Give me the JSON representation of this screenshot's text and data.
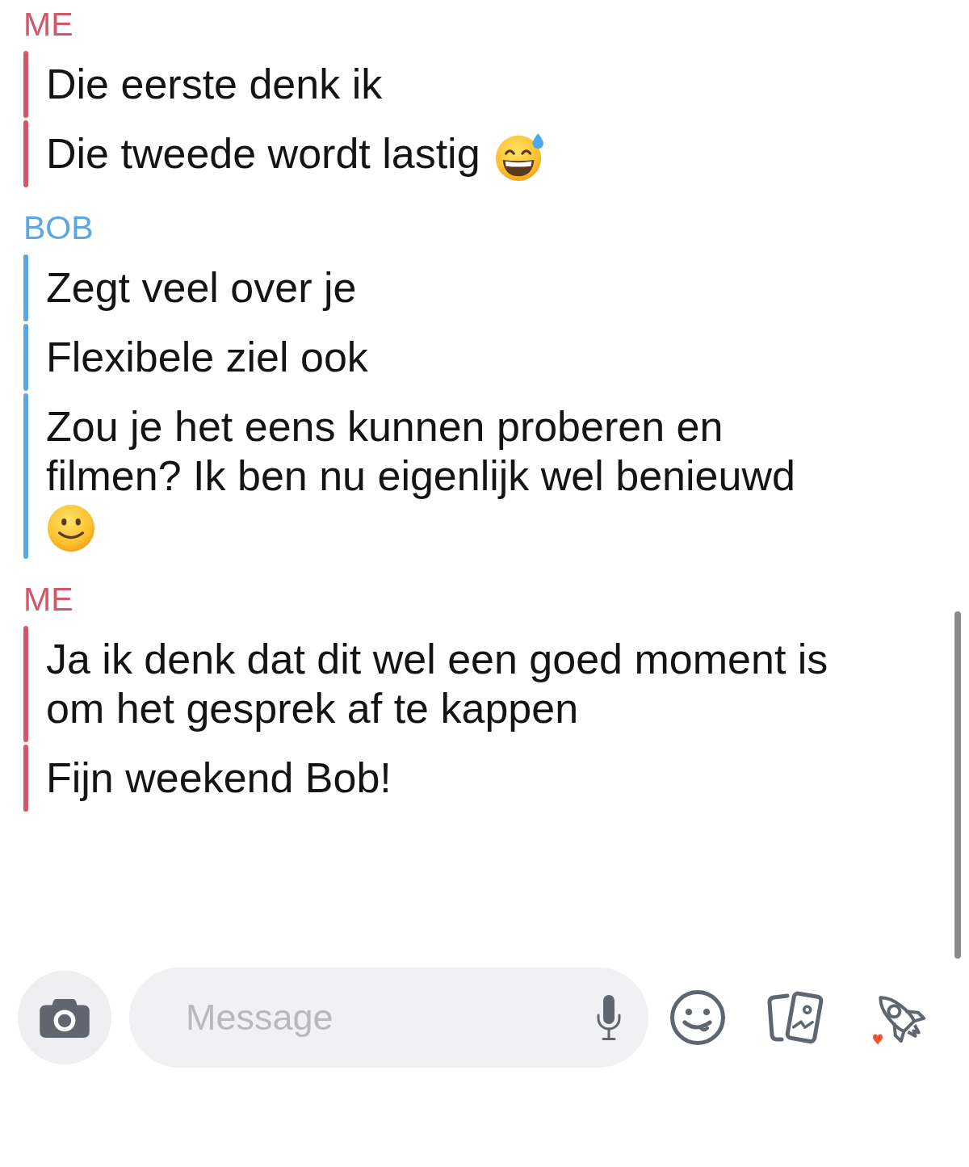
{
  "conversation": [
    {
      "sender": "ME",
      "color": "#d4566a",
      "messages": [
        {
          "kind": "plain",
          "text": "Die eerste denk ik"
        },
        {
          "kind": "grinsweat",
          "text": "Die tweede wordt lastig"
        }
      ]
    },
    {
      "sender": "BOB",
      "color": "#5aa7e4",
      "messages": [
        {
          "kind": "plain",
          "text": "Zegt veel over je"
        },
        {
          "kind": "plain",
          "text": "Flexibele ziel ook"
        },
        {
          "kind": "smile",
          "text": "Zou je het eens kunnen proberen en filmen? Ik ben nu eigenlijk wel benieuwd"
        }
      ]
    },
    {
      "sender": "ME",
      "color": "#d4566a",
      "messages": [
        {
          "kind": "plain",
          "text": "Ja ik denk dat dit wel een goed moment is om het gesprek af te kappen"
        },
        {
          "kind": "plain",
          "text": "Fijn weekend Bob!"
        }
      ]
    }
  ],
  "composer": {
    "placeholder": "Message"
  }
}
